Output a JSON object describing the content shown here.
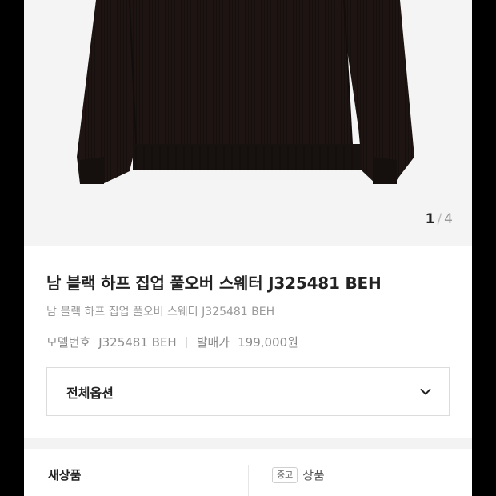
{
  "gallery": {
    "image_icon": "black-half-zip-pullover-sweater",
    "current_page": "1",
    "separator": "/",
    "total_pages": "4"
  },
  "product": {
    "title": "남 블랙 하프 집업 풀오버 스웨터 J325481 BEH",
    "subtitle": "남 블랙 하프 집업 풀오버 스웨터 J325481 BEH",
    "model_label": "모델번호",
    "model_value": "J325481 BEH",
    "price_label": "발매가",
    "price_value": "199,000원"
  },
  "options": {
    "label": "전체옵션",
    "icon": "chevron-down-icon"
  },
  "condition": {
    "new_label": "새상품",
    "used_badge": "중고",
    "used_label": "상품"
  },
  "colors": {
    "background": "#000000",
    "page": "#ffffff",
    "gallery_bg": "#f4f4f4",
    "sweater": "#1e1513"
  }
}
